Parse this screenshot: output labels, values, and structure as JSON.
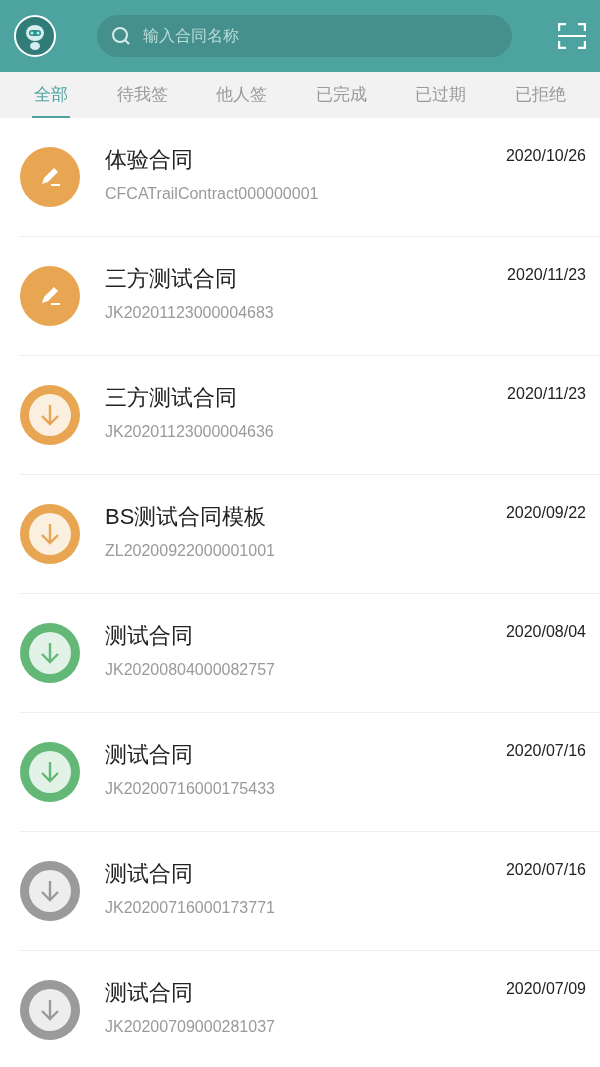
{
  "search": {
    "placeholder": "输入合同名称"
  },
  "tabs": [
    {
      "label": "全部",
      "selected": true
    },
    {
      "label": "待我签",
      "selected": false
    },
    {
      "label": "他人签",
      "selected": false
    },
    {
      "label": "已完成",
      "selected": false
    },
    {
      "label": "已过期",
      "selected": false
    },
    {
      "label": "已拒绝",
      "selected": false
    }
  ],
  "contracts": [
    {
      "title": "体验合同",
      "number": "CFCATrailContract000000001",
      "date": "2020/10/26",
      "kind": "sign",
      "color": "#e8a552"
    },
    {
      "title": "三方测试合同",
      "number": "JK20201123000004683",
      "date": "2020/11/23",
      "kind": "sign",
      "color": "#e8a552"
    },
    {
      "title": "三方测试合同",
      "number": "JK20201123000004636",
      "date": "2020/11/23",
      "kind": "download",
      "color": "#e8a552"
    },
    {
      "title": "BS测试合同模板",
      "number": "ZL20200922000001001",
      "date": "2020/09/22",
      "kind": "download",
      "color": "#e8a552"
    },
    {
      "title": "测试合同",
      "number": "JK20200804000082757",
      "date": "2020/08/04",
      "kind": "download",
      "color": "#63b878"
    },
    {
      "title": "测试合同",
      "number": "JK20200716000175433",
      "date": "2020/07/16",
      "kind": "download",
      "color": "#63b878"
    },
    {
      "title": "测试合同",
      "number": "JK20200716000173771",
      "date": "2020/07/16",
      "kind": "download",
      "color": "#9a9a9a"
    },
    {
      "title": "测试合同",
      "number": "JK20200709000281037",
      "date": "2020/07/09",
      "kind": "download",
      "color": "#9a9a9a"
    }
  ]
}
